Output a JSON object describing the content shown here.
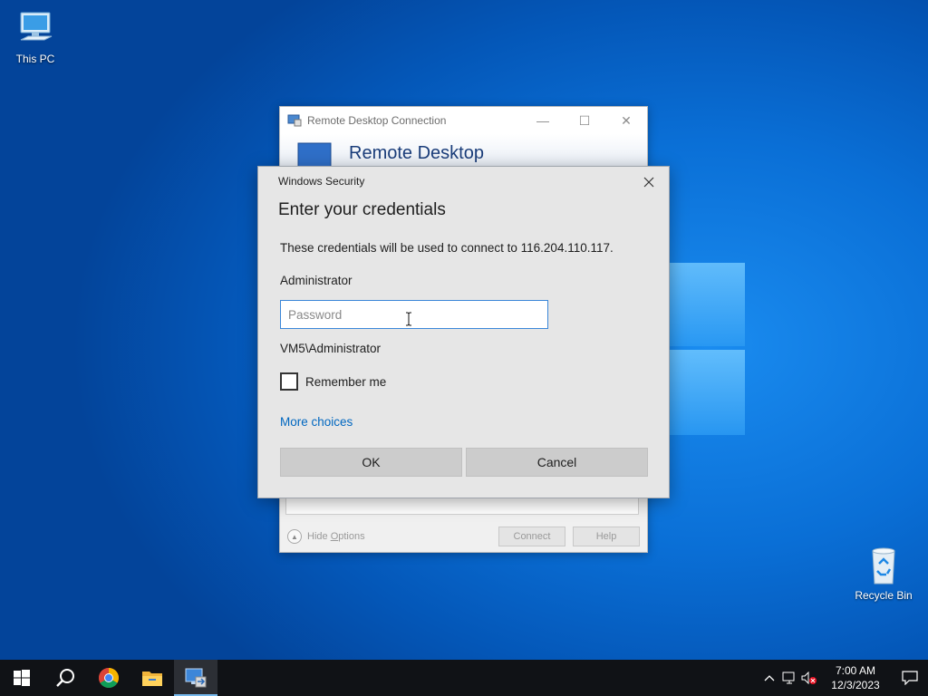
{
  "desktop": {
    "icons": [
      {
        "label": "This PC"
      },
      {
        "label": "Recycle Bin"
      }
    ]
  },
  "rdc_window": {
    "title": "Remote Desktop Connection",
    "banner_text": "Remote Desktop",
    "hide_options_prefix": "Hide ",
    "hide_options_underlined": "O",
    "hide_options_suffix": "ptions",
    "connect_label": "Connect",
    "help_label": "Help"
  },
  "security_dialog": {
    "title": "Windows Security",
    "heading": "Enter your credentials",
    "description": "These credentials will be used to connect to 116.204.110.117.",
    "username": "Administrator",
    "password_placeholder": "Password",
    "password_value": "",
    "domain_user": "VM5\\Administrator",
    "remember_me_label": "Remember me",
    "remember_me_checked": false,
    "more_choices_label": "More choices",
    "ok_label": "OK",
    "cancel_label": "Cancel"
  },
  "taskbar": {
    "items": [
      "start-icon",
      "search-icon",
      "chrome-icon",
      "file-explorer-icon",
      "remote-desktop-icon"
    ],
    "active_item": "remote-desktop-icon",
    "clock": {
      "time": "7:00 AM",
      "date": "12/3/2023"
    }
  },
  "colors": {
    "accent_link": "#0067c0",
    "input_border": "#3a86d8",
    "taskbar_bg": "#101216"
  }
}
